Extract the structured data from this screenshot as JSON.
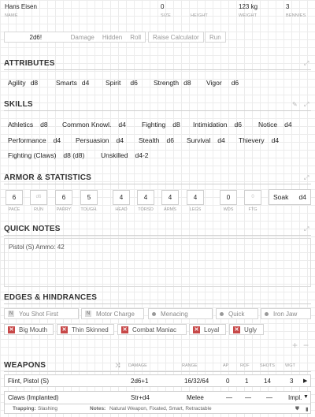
{
  "top": {
    "name": "Hans Eisen",
    "size": "0",
    "height": "",
    "weight": "123 kg",
    "bennies": "3",
    "labels": {
      "name": "NAME",
      "size": "SIZE",
      "height": "HEIGHT",
      "weight": "WEIGHT",
      "bennies": "BENNIES"
    }
  },
  "toolbar": {
    "dice": "2d6!",
    "damage": "Damage",
    "hidden": "Hidden",
    "roll": "Roll",
    "raise": "Raise Calculator",
    "run": "Run"
  },
  "attributes": {
    "title": "ATTRIBUTES",
    "items": [
      {
        "name": "Agility",
        "die": "d8"
      },
      {
        "name": "Smarts",
        "die": "d4"
      },
      {
        "name": "Spirit",
        "die": "d6"
      },
      {
        "name": "Strength",
        "die": "d8"
      },
      {
        "name": "Vigor",
        "die": "d6"
      }
    ]
  },
  "skills": {
    "title": "SKILLS",
    "items": [
      {
        "name": "Athletics",
        "die": "d8"
      },
      {
        "name": "Common Knowl.",
        "die": "d4"
      },
      {
        "name": "Fighting",
        "die": "d8"
      },
      {
        "name": "Intimidation",
        "die": "d6"
      },
      {
        "name": "Notice",
        "die": "d4"
      },
      {
        "name": "Performance",
        "die": "d4"
      },
      {
        "name": "Persuasion",
        "die": "d4"
      },
      {
        "name": "Stealth",
        "die": "d6"
      },
      {
        "name": "Survival",
        "die": "d4"
      },
      {
        "name": "Thievery",
        "die": "d4"
      },
      {
        "name": "Fighting (Claws)",
        "die": "d8 (d8)"
      },
      {
        "name": "Unskilled",
        "die": "d4-2"
      }
    ]
  },
  "armor": {
    "title": "ARMOR & STATISTICS",
    "stats": [
      {
        "label": "PACE",
        "value": "6"
      },
      {
        "label": "RUN",
        "value": "d6"
      },
      {
        "label": "PARRY",
        "value": "6"
      },
      {
        "label": "TOUGH.",
        "value": "5"
      },
      {
        "label": "HEAD",
        "value": "4"
      },
      {
        "label": "TORSO",
        "value": "4"
      },
      {
        "label": "ARMS",
        "value": "4"
      },
      {
        "label": "LEGS",
        "value": "4"
      },
      {
        "label": "WDS",
        "value": "0"
      },
      {
        "label": "FTG",
        "value": "0"
      }
    ],
    "soak_label": "Soak",
    "soak_die": "d4"
  },
  "notes": {
    "title": "QUICK NOTES",
    "text": "Pistol (S) Ammo: 42"
  },
  "edges": {
    "title": "EDGES & HINDRANCES",
    "edges": [
      {
        "mark": "N",
        "label": "You Shot First"
      },
      {
        "mark": "N",
        "label": "Motor Charge"
      },
      {
        "mark": "dot",
        "label": "Menacing"
      },
      {
        "mark": "dot",
        "label": "Quick"
      },
      {
        "mark": "dot",
        "label": "Iron Jaw"
      }
    ],
    "hindrances": [
      {
        "label": "Big Mouth"
      },
      {
        "label": "Thin Skinned"
      },
      {
        "label": "Combat Maniac"
      },
      {
        "label": "Loyal"
      },
      {
        "label": "Ugly"
      }
    ],
    "add": "+",
    "remove": "−"
  },
  "weapons": {
    "title": "WEAPONS",
    "headers": {
      "damage": "DAMAGE",
      "range": "RANGE",
      "ap": "AP",
      "rof": "ROF",
      "shots": "SHOTS",
      "wgt": "WGT"
    },
    "rows": [
      {
        "name": "Flint, Pistol (S)",
        "damage": "2d6+1",
        "range": "16/32/64",
        "ap": "0",
        "rof": "1",
        "shots": "14",
        "wgt": "3"
      },
      {
        "name": "Claws (Implanted)",
        "damage": "Str+d4",
        "range": "Melee",
        "ap": "—",
        "rof": "—",
        "shots": "—",
        "wgt": "Impl."
      }
    ],
    "trapping_label": "Trapping:",
    "trapping_value": "Slashing",
    "notes_label": "Notes:",
    "notes_value": "Natural Weapon, Fixated, Smart, Retractable"
  }
}
